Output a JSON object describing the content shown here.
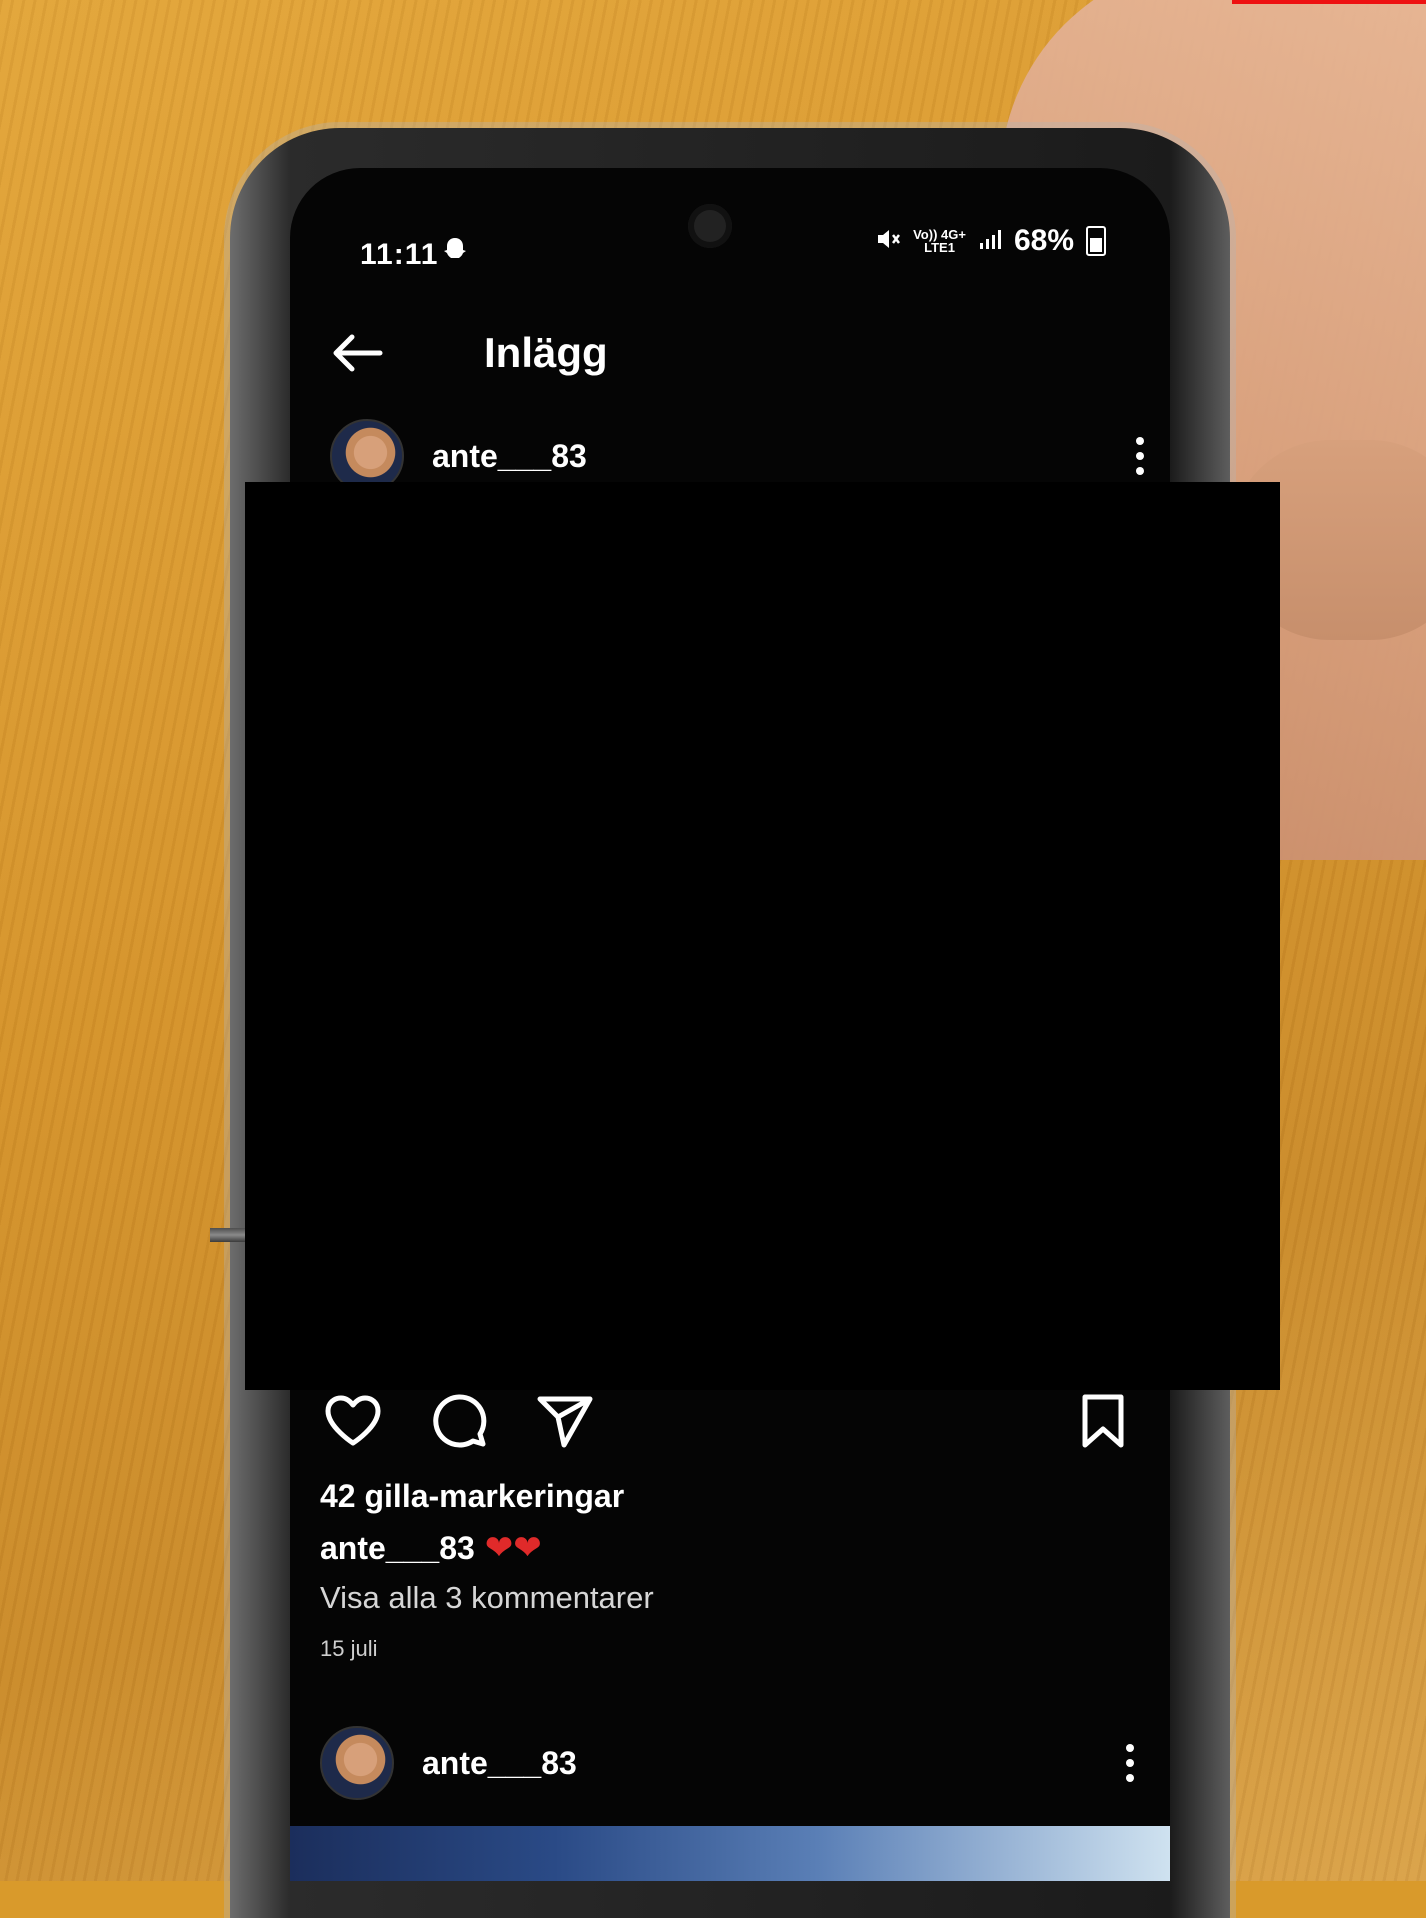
{
  "status_bar": {
    "time": "11:11",
    "network_top": "Vo)) 4G+",
    "network_bottom": "LTE1",
    "battery": "68%"
  },
  "header": {
    "title": "Inlägg"
  },
  "post": {
    "username": "ante___83",
    "likes": "42 gilla-markeringar",
    "caption_user": "ante___83",
    "caption_text": "❤❤",
    "comments_link": "Visa alla 3 kommentarer",
    "date": "15 juli"
  },
  "next_post": {
    "username": "ante___83"
  },
  "icons": {
    "back": "arrow-left-icon",
    "more": "more-vertical-icon",
    "like": "heart-icon",
    "comment": "comment-icon",
    "share": "send-icon",
    "save": "bookmark-icon",
    "snapchat": "snapchat-ghost-icon"
  }
}
